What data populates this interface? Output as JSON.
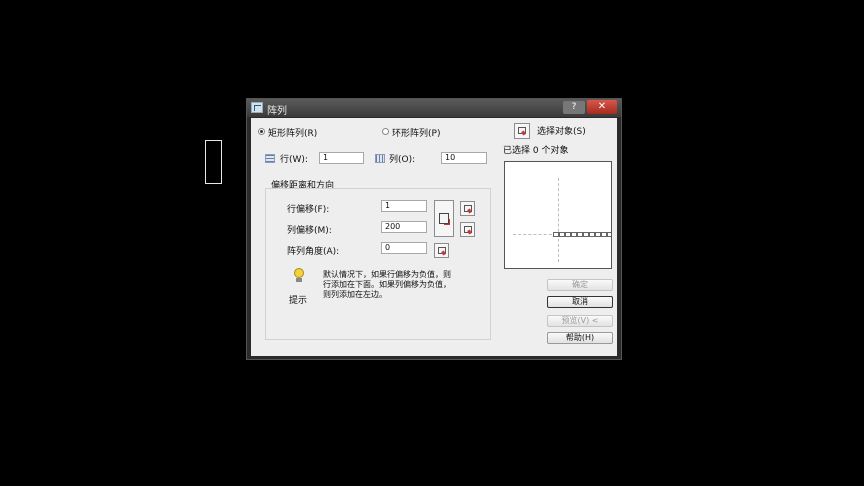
{
  "window": {
    "title": "阵列",
    "help_glyph": "?",
    "close_glyph": "✕"
  },
  "array_type": {
    "rectangular_label": "矩形阵列(R)",
    "polar_label": "环形阵列(P)",
    "selected": "rectangular"
  },
  "rows": {
    "label": "行(W):",
    "value": "1"
  },
  "columns": {
    "label": "列(O):",
    "value": "10"
  },
  "offset_group": {
    "title": "偏移距离和方向",
    "row_offset": {
      "label": "行偏移(F):",
      "value": "1"
    },
    "column_offset": {
      "label": "列偏移(M):",
      "value": "200"
    },
    "angle": {
      "label": "阵列角度(A):",
      "value": "0"
    }
  },
  "tip": {
    "label": "提示",
    "text_lines": [
      "默认情况下，如果行偏移为负值，则",
      "行添加在下面。如果列偏移为负值，",
      "则列添加在左边。"
    ]
  },
  "select_objects": {
    "label": "选择对象(S)",
    "status": "已选择 0 个对象"
  },
  "buttons": {
    "ok": "确定",
    "cancel": "取消",
    "preview": "预览(V) <",
    "help": "帮助(H)"
  }
}
